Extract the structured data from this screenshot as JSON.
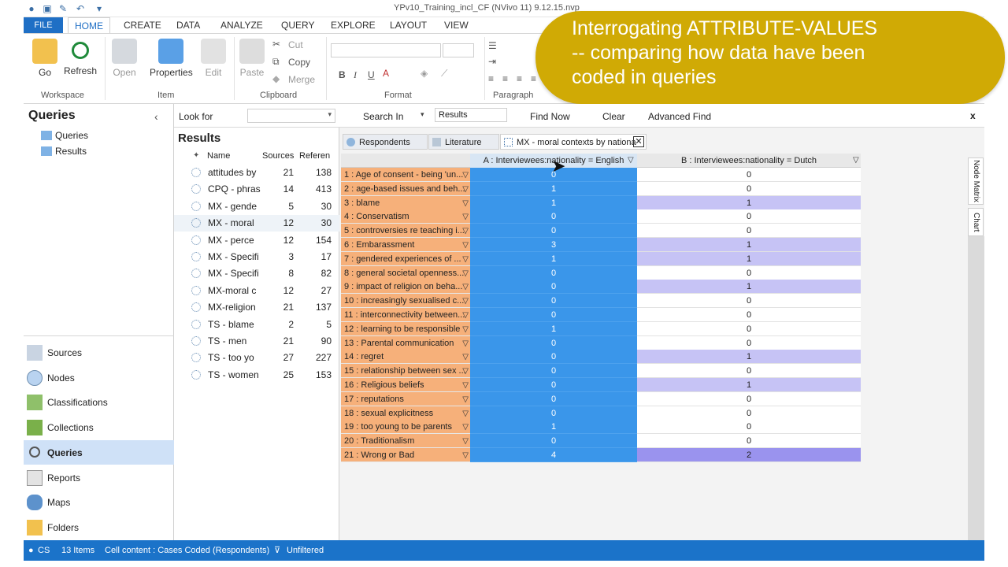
{
  "window": {
    "title": "YPv10_Training_incl_CF (NVivo 11) 9.12.15.nvp"
  },
  "ribbon_tabs": [
    "FILE",
    "HOME",
    "CREATE",
    "DATA",
    "ANALYZE",
    "QUERY",
    "EXPLORE",
    "LAYOUT",
    "VIEW"
  ],
  "ribbon": {
    "go": "Go",
    "refresh": "Refresh",
    "open": "Open",
    "properties": "Properties",
    "edit": "Edit",
    "paste": "Paste",
    "cut": "Cut",
    "copy": "Copy",
    "merge": "Merge",
    "bold": "B",
    "italic": "I",
    "underline": "U",
    "groups": {
      "workspace": "Workspace",
      "item": "Item",
      "clipboard": "Clipboard",
      "format": "Format",
      "paragraph": "Paragraph"
    }
  },
  "banner": {
    "line1": "Interrogating ATTRIBUTE-VALUES",
    "line2": "-- comparing how data have been",
    "line3": "coded in queries"
  },
  "nav": {
    "title": "Queries",
    "tree": [
      "Queries",
      "Results"
    ],
    "buttons": [
      "Sources",
      "Nodes",
      "Classifications",
      "Collections",
      "Queries",
      "Reports",
      "Maps",
      "Folders"
    ]
  },
  "findbar": {
    "look_for": "Look for",
    "search_in": "Search In",
    "search_in_value": "Results",
    "find_now": "Find Now",
    "clear": "Clear",
    "advanced_find": "Advanced Find",
    "close": "x"
  },
  "results": {
    "title": "Results",
    "columns": [
      "Name",
      "Sources",
      "Referen"
    ],
    "rows": [
      {
        "name": "attitudes by",
        "sources": "21",
        "refs": "138"
      },
      {
        "name": "CPQ - phras",
        "sources": "14",
        "refs": "413"
      },
      {
        "name": "MX - gende",
        "sources": "5",
        "refs": "30"
      },
      {
        "name": "MX - moral",
        "sources": "12",
        "refs": "30"
      },
      {
        "name": "MX - perce",
        "sources": "12",
        "refs": "154"
      },
      {
        "name": "MX - Specifi",
        "sources": "3",
        "refs": "17"
      },
      {
        "name": "MX - Specifi",
        "sources": "8",
        "refs": "82"
      },
      {
        "name": "MX-moral c",
        "sources": "12",
        "refs": "27"
      },
      {
        "name": "MX-religion",
        "sources": "21",
        "refs": "137"
      },
      {
        "name": "TS - blame",
        "sources": "2",
        "refs": "5"
      },
      {
        "name": "TS - men",
        "sources": "21",
        "refs": "90"
      },
      {
        "name": "TS - too yo",
        "sources": "27",
        "refs": "227"
      },
      {
        "name": "TS - women",
        "sources": "25",
        "refs": "153"
      }
    ]
  },
  "doc_tabs": [
    "Respondents",
    "Literature",
    "MX - moral contexts by nationa"
  ],
  "matrix": {
    "col_a": "A : Interviewees:nationality = English",
    "col_b": "B : Interviewees:nationality = Dutch",
    "rows": [
      {
        "label": "1 : Age of consent - being 'un...",
        "a": "0",
        "b": "0"
      },
      {
        "label": "2 : age-based issues and beh...",
        "a": "1",
        "b": "0"
      },
      {
        "label": "3 : blame",
        "a": "1",
        "b": "1"
      },
      {
        "label": "4 : Conservatism",
        "a": "0",
        "b": "0"
      },
      {
        "label": "5 : controversies re teaching i...",
        "a": "0",
        "b": "0"
      },
      {
        "label": "6 : Embarassment",
        "a": "3",
        "b": "1"
      },
      {
        "label": "7 : gendered experiences of ...",
        "a": "1",
        "b": "1"
      },
      {
        "label": "8 : general societal openness...",
        "a": "0",
        "b": "0"
      },
      {
        "label": "9 : impact of religion on beha...",
        "a": "0",
        "b": "1"
      },
      {
        "label": "10 : increasingly sexualised c...",
        "a": "0",
        "b": "0"
      },
      {
        "label": "11 : interconnectivity between...",
        "a": "0",
        "b": "0"
      },
      {
        "label": "12 : learning to be responsible",
        "a": "1",
        "b": "0"
      },
      {
        "label": "13 : Parental communication",
        "a": "0",
        "b": "0"
      },
      {
        "label": "14 : regret",
        "a": "0",
        "b": "1"
      },
      {
        "label": "15 : relationship between sex ...",
        "a": "0",
        "b": "0"
      },
      {
        "label": "16 : Religious beliefs",
        "a": "0",
        "b": "1"
      },
      {
        "label": "17 : reputations",
        "a": "0",
        "b": "0"
      },
      {
        "label": "18 : sexual explicitness",
        "a": "0",
        "b": "0"
      },
      {
        "label": "19 : too young to be parents",
        "a": "1",
        "b": "0"
      },
      {
        "label": "20 : Traditionalism",
        "a": "0",
        "b": "0"
      },
      {
        "label": "21 : Wrong or Bad",
        "a": "4",
        "b": "2"
      }
    ],
    "side_tabs": [
      "Node Matrix",
      "Chart"
    ]
  },
  "status": {
    "user": "CS",
    "items": "13 Items",
    "cell_content": "Cell content : Cases Coded (Respondents)",
    "filter": "Unfiltered"
  },
  "colors": {
    "accent": "#1f6fc5",
    "banner": "#d0aa05",
    "row_header": "#f6b07a",
    "col_a": "#3a96ea",
    "col_b_shaded": "#c6c3f5",
    "col_b_strong": "#9a93ee"
  }
}
